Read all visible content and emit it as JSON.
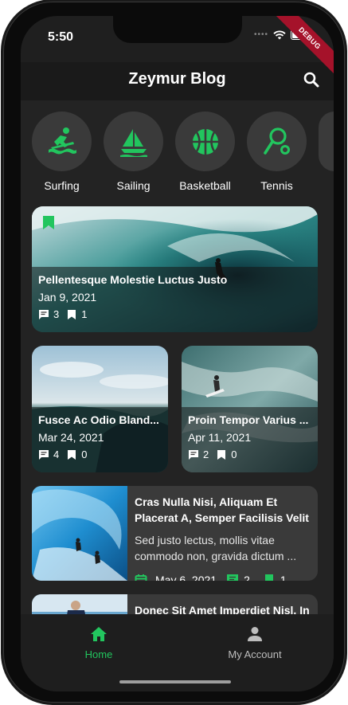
{
  "status": {
    "time": "5:50",
    "dots": "••••",
    "debug_label": "DEBUG"
  },
  "appbar": {
    "title": "Zeymur Blog"
  },
  "categories": [
    {
      "label": "Surfing",
      "icon": "surfing-icon"
    },
    {
      "label": "Sailing",
      "icon": "sailing-icon"
    },
    {
      "label": "Basketball",
      "icon": "basketball-icon"
    },
    {
      "label": "Tennis",
      "icon": "tennis-icon"
    }
  ],
  "featured": {
    "title": "Pellentesque Molestie Luctus Justo",
    "date": "Jan 9, 2021",
    "comments": "3",
    "bookmarks": "1"
  },
  "grid": [
    {
      "title": "Fusce Ac Odio Bland...",
      "date": "Mar 24, 2021",
      "comments": "4",
      "bookmarks": "0"
    },
    {
      "title": "Proin Tempor Varius ...",
      "date": "Apr 11, 2021",
      "comments": "2",
      "bookmarks": "0"
    }
  ],
  "list": [
    {
      "title": "Cras Nulla Nisi, Aliquam Et Placerat A, Semper Facilisis Velit",
      "excerpt": "Sed justo lectus, mollis vitae commodo non, gravida dictum ...",
      "date": "May 6, 2021",
      "comments": "2",
      "bookmarks": "1"
    },
    {
      "title": "Donec Sit Amet Imperdiet Nisl, In"
    }
  ],
  "nav": {
    "home": "Home",
    "account": "My Account"
  },
  "colors": {
    "accent": "#22c55e",
    "background": "#232323",
    "card": "#3a3a3a"
  }
}
